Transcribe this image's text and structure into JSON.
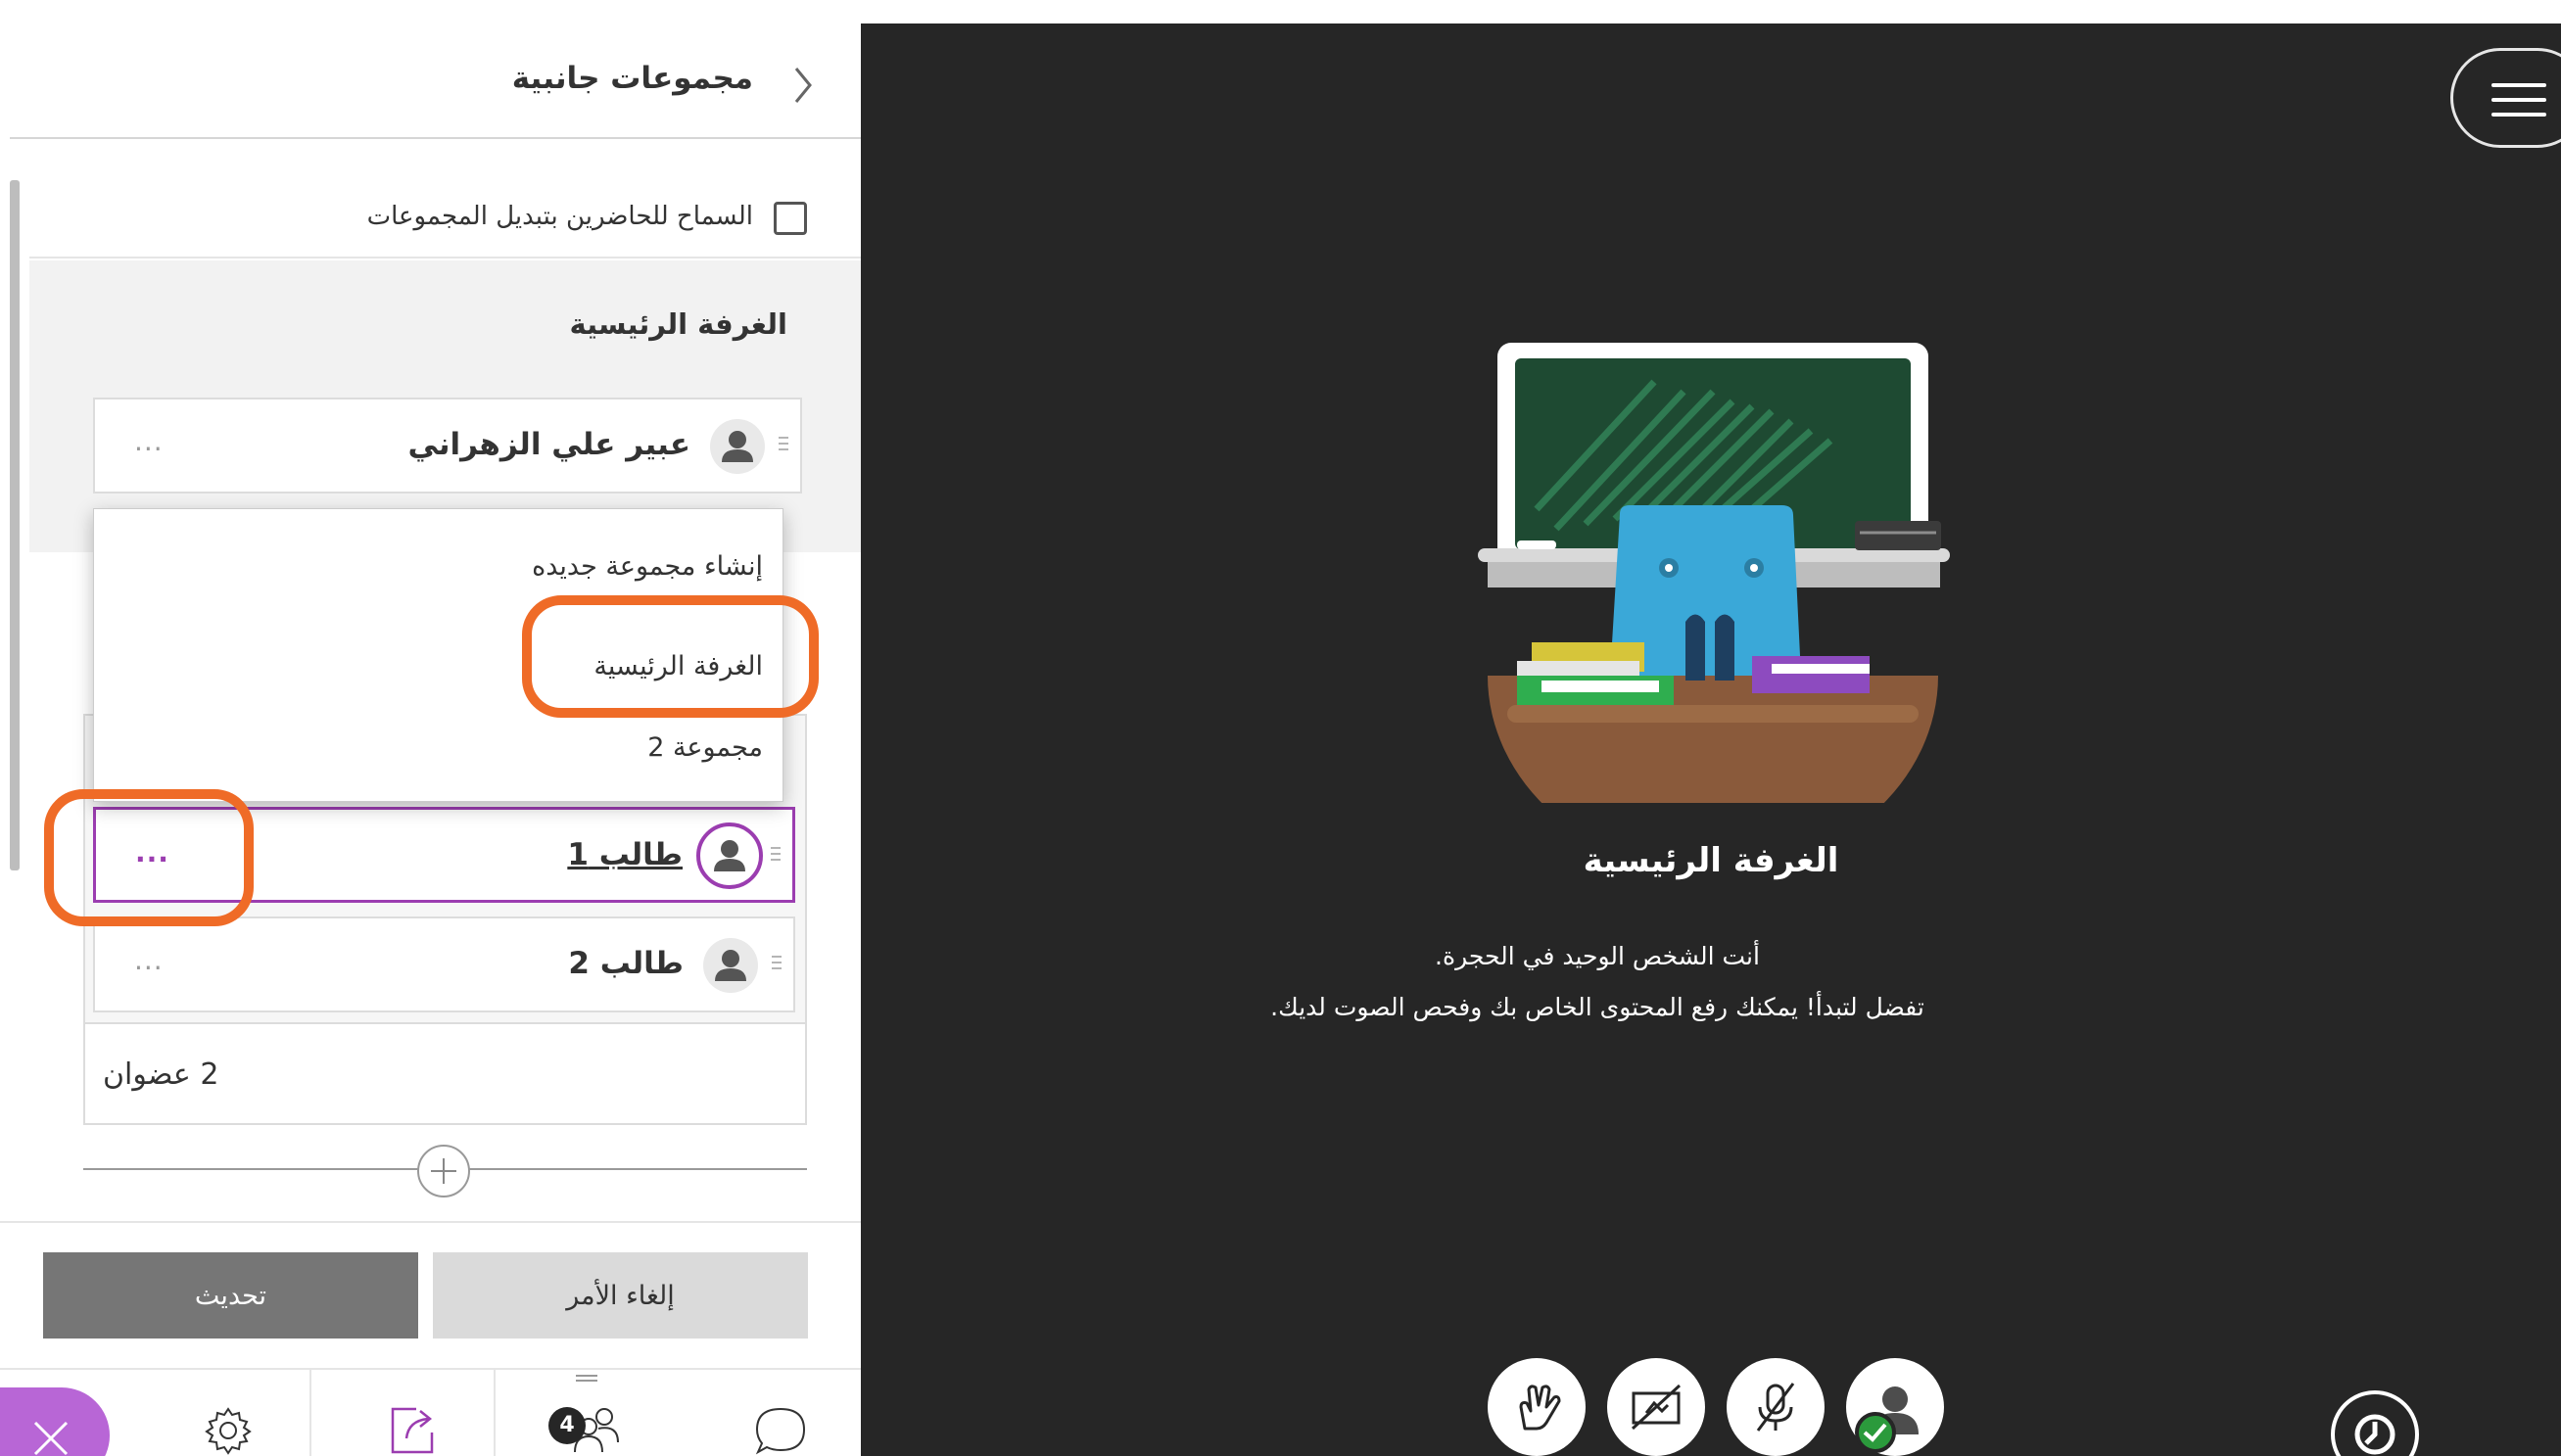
{
  "panel": {
    "title": "مجموعات جانبية",
    "allow_switch_label": "السماح للحاضرين بتبديل المجموعات",
    "allow_switch_checked": false,
    "main_room": {
      "title": "الغرفة الرئيسية",
      "members": [
        {
          "name": "عبير علي الزهراني",
          "more": "···"
        }
      ]
    },
    "dropdown": {
      "items": [
        "إنشاء مجموعة جديده",
        "الغرفة الرئيسية",
        "مجموعة 2"
      ]
    },
    "group": {
      "members": [
        {
          "name": "طالب 1",
          "more": "···",
          "selected": true
        },
        {
          "name": "طالب 2",
          "more": "···",
          "selected": false
        }
      ],
      "members_count": "2 عضوان"
    },
    "buttons": {
      "update": "تحديث",
      "cancel": "إلغاء الأمر"
    },
    "tabs": {
      "attendees_badge": "4"
    }
  },
  "stage": {
    "title": "الغرفة الرئيسية",
    "line1": "أنت الشخص الوحيد في الحجرة.",
    "line2": "تفضل لتبدأ! يمكنك رفع المحتوى الخاص بك وفحص الصوت لديك."
  },
  "colors": {
    "accent_purple": "#9b3db0",
    "close_purple": "#b866d6",
    "highlight_orange": "#ef6b27",
    "stage_bg": "#262626",
    "status_green": "#2b9a3c"
  },
  "icons": [
    "chevron-right-icon",
    "checkbox-icon",
    "user-icon",
    "ellipsis-icon",
    "plus-icon",
    "close-icon",
    "gear-icon",
    "share-icon",
    "attendees-icon",
    "chat-icon",
    "menu-icon",
    "hand-raise-icon",
    "camera-off-icon",
    "mic-off-icon",
    "status-check-icon",
    "clock-icon"
  ]
}
